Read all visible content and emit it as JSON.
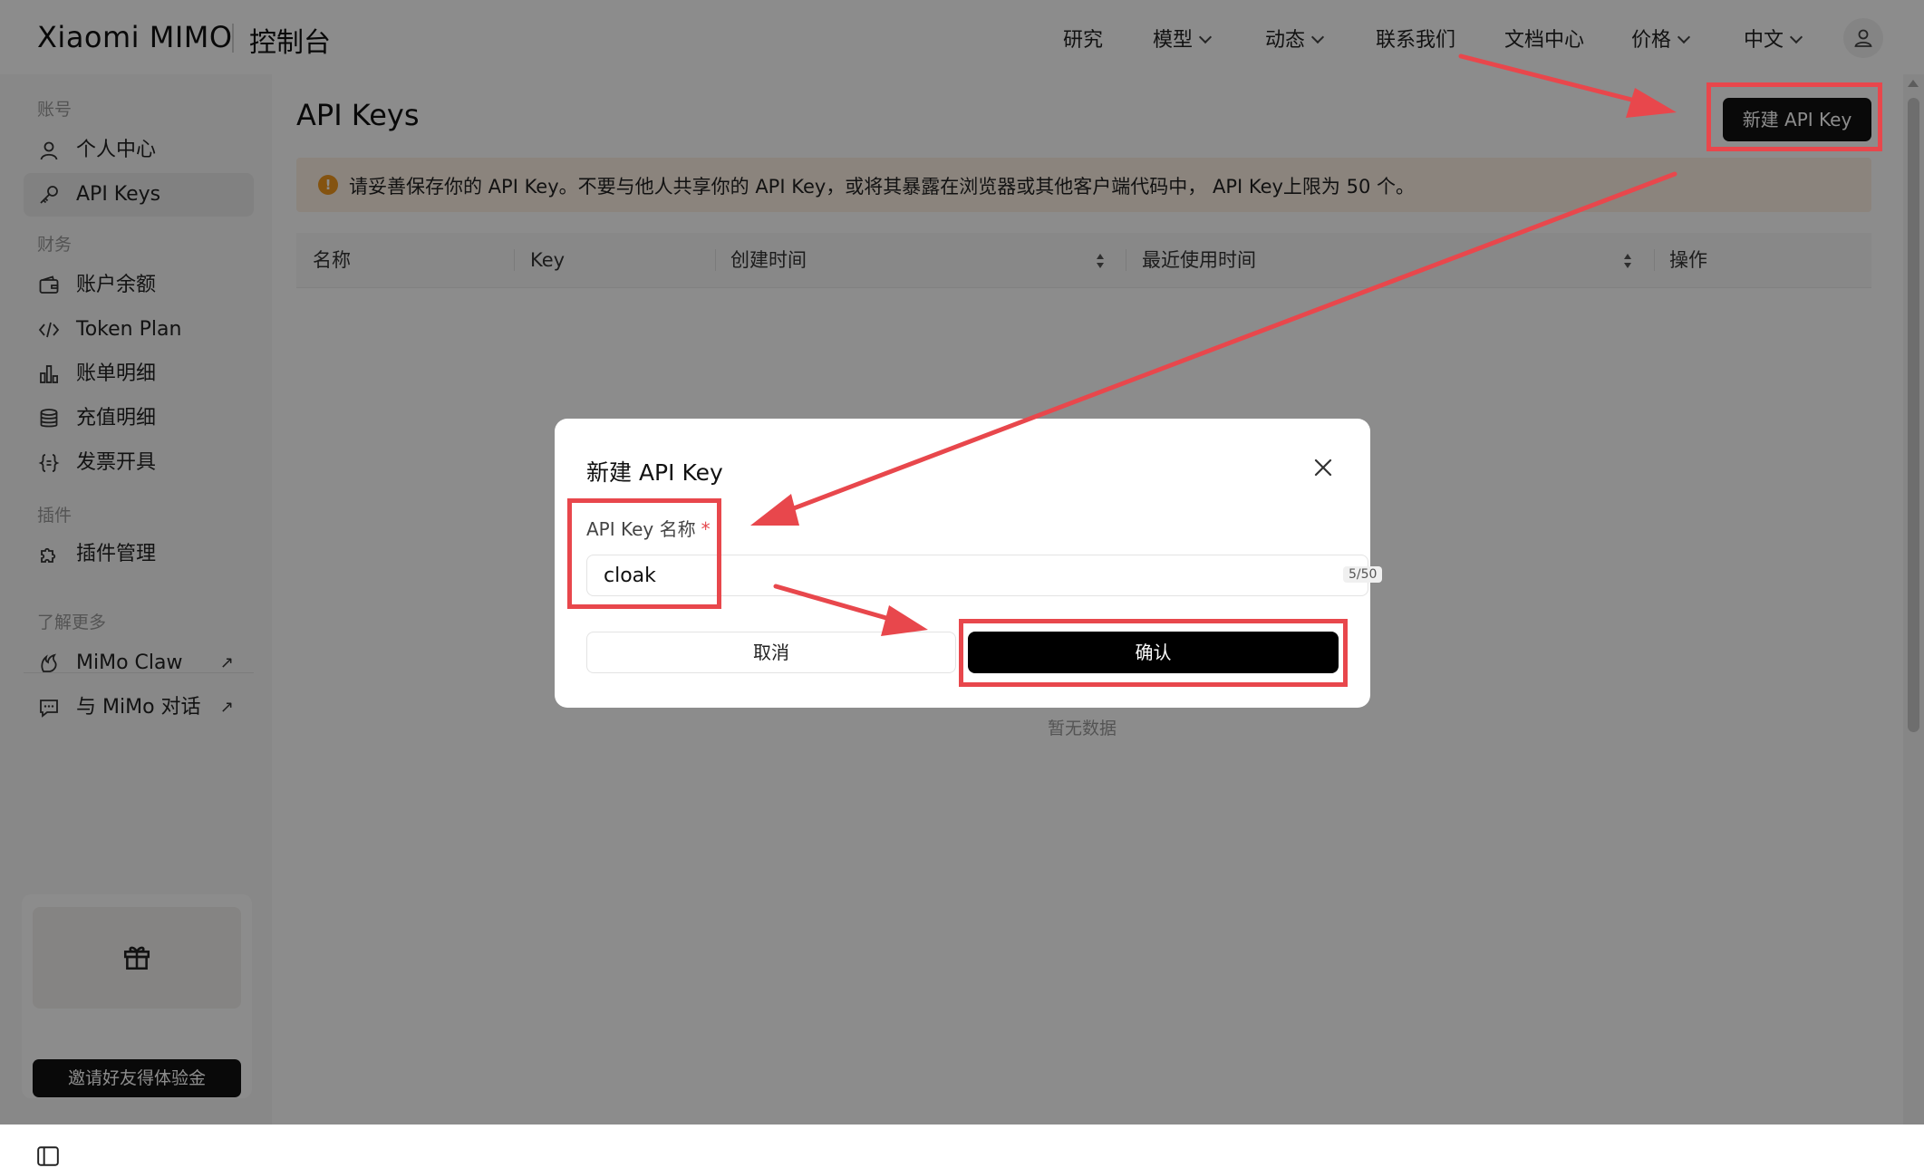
{
  "brand": {
    "name": "Xiaomi MIMO",
    "console": "控制台"
  },
  "nav": {
    "items": [
      {
        "label": "研究",
        "dropdown": false
      },
      {
        "label": "模型",
        "dropdown": true
      },
      {
        "label": "动态",
        "dropdown": true
      },
      {
        "label": "联系我们",
        "dropdown": false
      },
      {
        "label": "文档中心",
        "dropdown": false
      },
      {
        "label": "价格",
        "dropdown": true
      },
      {
        "label": "中文",
        "dropdown": true
      }
    ],
    "avatar_icon": "user-icon"
  },
  "sidebar": {
    "groups": [
      {
        "label": "账号"
      },
      {
        "label": "财务"
      },
      {
        "label": "插件"
      },
      {
        "label": "了解更多"
      }
    ],
    "items": [
      {
        "label": "个人中心",
        "icon": "user-icon",
        "active": false
      },
      {
        "label": "API Keys",
        "icon": "key-icon",
        "active": true
      },
      {
        "label": "账户余额",
        "icon": "wallet-icon",
        "active": false
      },
      {
        "label": "Token Plan",
        "icon": "code-icon",
        "active": false
      },
      {
        "label": "账单明细",
        "icon": "bar-chart-icon",
        "active": false
      },
      {
        "label": "充值明细",
        "icon": "database-icon",
        "active": false
      },
      {
        "label": "发票开具",
        "icon": "braces-icon",
        "active": false
      },
      {
        "label": "插件管理",
        "icon": "puzzle-icon",
        "active": false
      },
      {
        "label": "MiMo Claw",
        "icon": "claw-icon",
        "external": true
      },
      {
        "label": "与 MiMo 对话",
        "icon": "chat-icon",
        "external": true
      }
    ],
    "external_glyph": "↗",
    "invite_button": "邀请好友得体验金"
  },
  "main": {
    "title": "API Keys",
    "new_key_button": "新建 API Key",
    "alert_icon": "!",
    "alert_text": "请妥善保存你的 API Key。不要与他人共享你的 API Key，或将其暴露在浏览器或其他客户端代码中， API Key上限为 50 个。",
    "columns": [
      "名称",
      "Key",
      "创建时间",
      "最近使用时间",
      "操作"
    ],
    "empty_text": "暂无数据"
  },
  "modal": {
    "title": "新建 API Key",
    "field_label": "API Key 名称",
    "required_mark": "*",
    "field_value": "cloak",
    "counter": "5/50",
    "cancel": "取消",
    "confirm": "确认"
  },
  "colors": {
    "accent": "#000000",
    "annotation": "#e8474c",
    "alert_bg": "#fdf0e4",
    "alert_icon": "#f0971e"
  }
}
